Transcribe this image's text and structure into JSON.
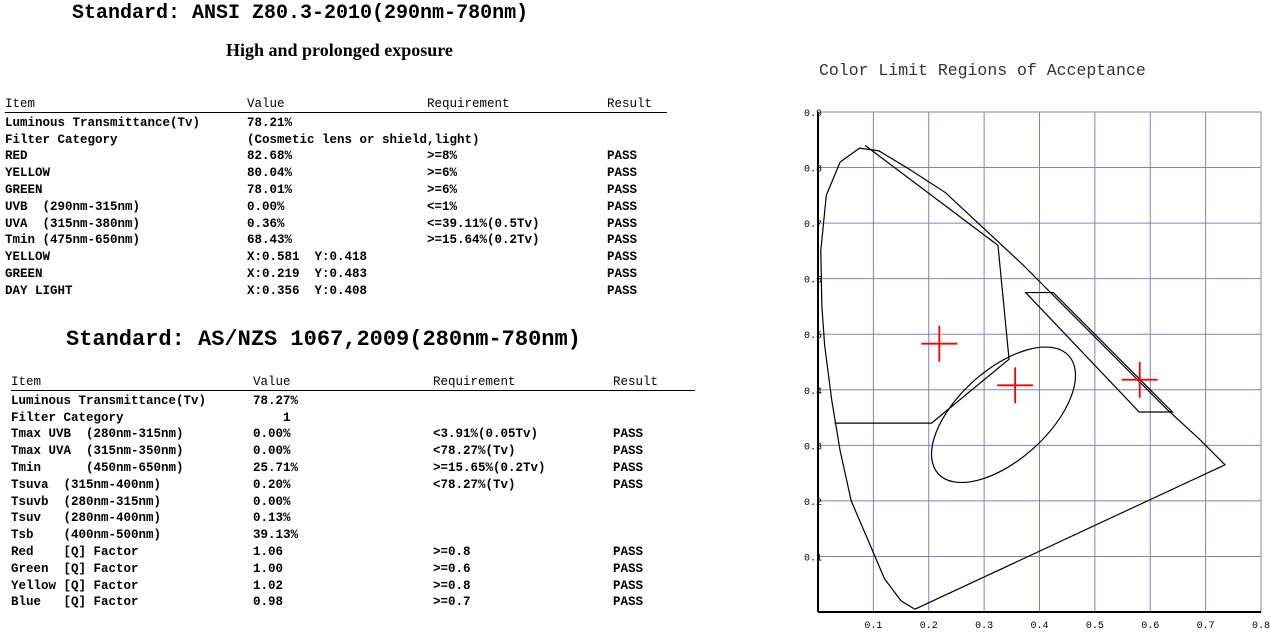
{
  "section1": {
    "title": "Standard: ANSI Z80.3-2010(290nm-780nm)",
    "subtitle": "High and prolonged exposure",
    "headers": [
      "Item",
      "Value",
      "Requirement",
      "Result"
    ],
    "rows": [
      [
        "Luminous Transmittance(Tv)",
        "78.21%",
        "",
        ""
      ],
      [
        "Filter Category",
        "(Cosmetic lens or shield,light)",
        "",
        ""
      ],
      [
        "RED",
        "82.68%",
        ">=8%",
        "PASS"
      ],
      [
        "YELLOW",
        "80.04%",
        ">=6%",
        "PASS"
      ],
      [
        "GREEN",
        "78.01%",
        ">=6%",
        "PASS"
      ],
      [
        "UVB  (290nm-315nm)",
        "0.00%",
        "<=1%",
        "PASS"
      ],
      [
        "UVA  (315nm-380nm)",
        "0.36%",
        "<=39.11%(0.5Tv)",
        "PASS"
      ],
      [
        "Tmin (475nm-650nm)",
        "68.43%",
        ">=15.64%(0.2Tv)",
        "PASS"
      ],
      [
        "YELLOW",
        "X:0.581  Y:0.418",
        "",
        "PASS"
      ],
      [
        "GREEN",
        "X:0.219  Y:0.483",
        "",
        "PASS"
      ],
      [
        "DAY LIGHT",
        "X:0.356  Y:0.408",
        "",
        "PASS"
      ]
    ]
  },
  "section2": {
    "title": "Standard: AS/NZS 1067,2009(280nm-780nm)",
    "headers": [
      "Item",
      "Value",
      "Requirement",
      "Result"
    ],
    "rows": [
      [
        "Luminous Transmittance(Tv)",
        "78.27%",
        "",
        ""
      ],
      [
        "Filter Category",
        "    1",
        "",
        ""
      ],
      [
        "Tmax UVB  (280nm-315nm)",
        "0.00%",
        "<3.91%(0.05Tv)",
        "PASS"
      ],
      [
        "Tmax UVA  (315nm-350nm)",
        "0.00%",
        "<78.27%(Tv)",
        "PASS"
      ],
      [
        "Tmin      (450nm-650nm)",
        "25.71%",
        ">=15.65%(0.2Tv)",
        "PASS"
      ],
      [
        "Tsuva  (315nm-400nm)",
        "0.20%",
        "<78.27%(Tv)",
        "PASS"
      ],
      [
        "Tsuvb  (280nm-315nm)",
        "0.00%",
        "",
        ""
      ],
      [
        "Tsuv   (280nm-400nm)",
        "0.13%",
        "",
        ""
      ],
      [
        "Tsb    (400nm-500nm)",
        "39.13%",
        "",
        ""
      ],
      [
        "Red    [Q] Factor",
        "1.06",
        ">=0.8",
        "PASS"
      ],
      [
        "Green  [Q] Factor",
        "1.00",
        ">=0.6",
        "PASS"
      ],
      [
        "Yellow [Q] Factor",
        "1.02",
        ">=0.8",
        "PASS"
      ],
      [
        "Blue   [Q] Factor",
        "0.98",
        ">=0.7",
        "PASS"
      ]
    ]
  },
  "chart_data": {
    "type": "scatter",
    "title": "Color Limit Regions of Acceptance",
    "xlim": [
      0,
      0.8
    ],
    "ylim": [
      0,
      0.9
    ],
    "x_ticks": [
      "0.1",
      "0.2",
      "0.3",
      "0.4",
      "0.5",
      "0.6",
      "0.7",
      "0.8"
    ],
    "y_ticks": [
      "0.1",
      "0.2",
      "0.3",
      "0.4",
      "0.5",
      "0.6",
      "0.7",
      "0.8",
      "0.9"
    ],
    "grid": true,
    "points": [
      {
        "x": 0.219,
        "y": 0.483
      },
      {
        "x": 0.356,
        "y": 0.408
      },
      {
        "x": 0.581,
        "y": 0.418
      }
    ],
    "colors": {
      "grid": "#8080c8",
      "marker": "#ff0000",
      "outline": "#000000"
    }
  }
}
